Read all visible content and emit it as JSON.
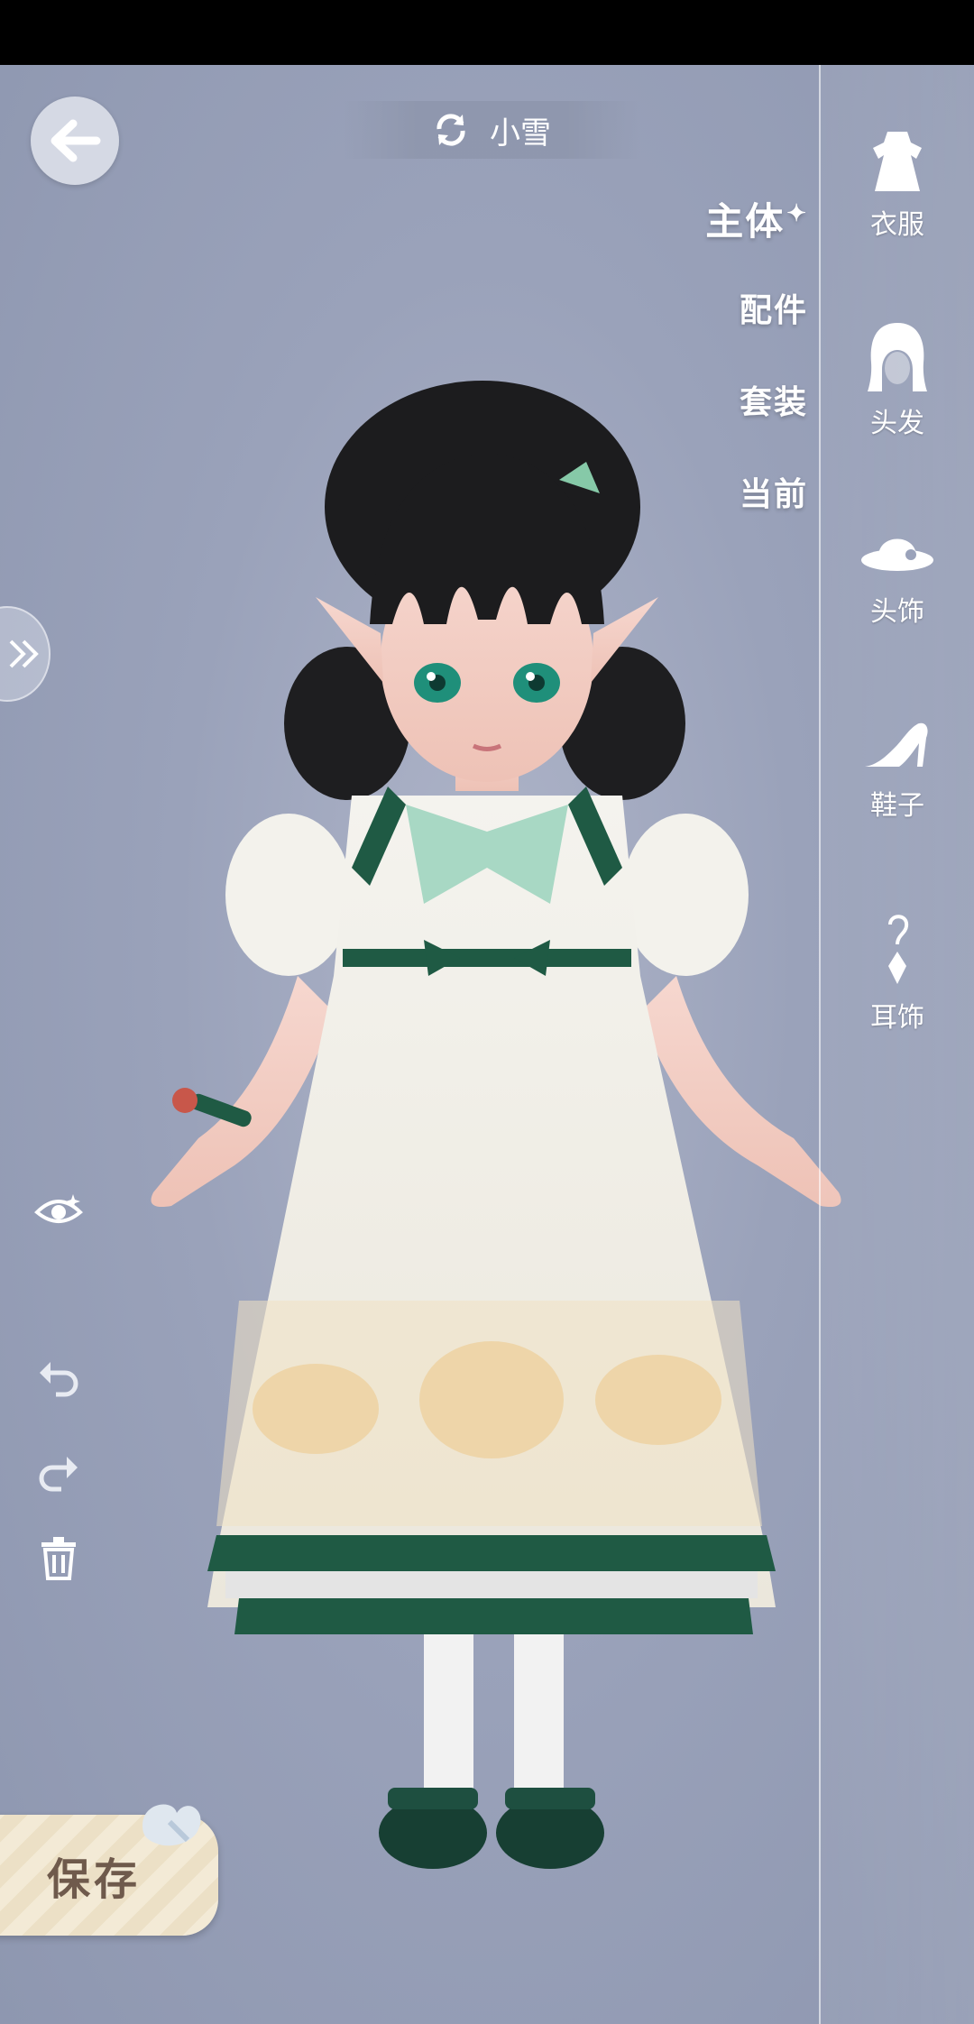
{
  "header": {
    "character_name": "小雪"
  },
  "subtabs": [
    {
      "label": "主体",
      "active": true
    },
    {
      "label": "配件",
      "active": false
    },
    {
      "label": "套装",
      "active": false
    },
    {
      "label": "当前",
      "active": false
    }
  ],
  "categories": [
    {
      "label": "衣服",
      "icon": "dress-icon"
    },
    {
      "label": "头发",
      "icon": "hair-icon"
    },
    {
      "label": "头饰",
      "icon": "hat-icon"
    },
    {
      "label": "鞋子",
      "icon": "high-heel-icon"
    },
    {
      "label": "耳饰",
      "icon": "earring-icon"
    }
  ],
  "footer": {
    "save_label": "保存"
  },
  "colors": {
    "background": "#9aa2ba",
    "dress_green": "#1f5a44",
    "dress_white": "#f1f0ea",
    "save_text": "#6f5a4c"
  }
}
